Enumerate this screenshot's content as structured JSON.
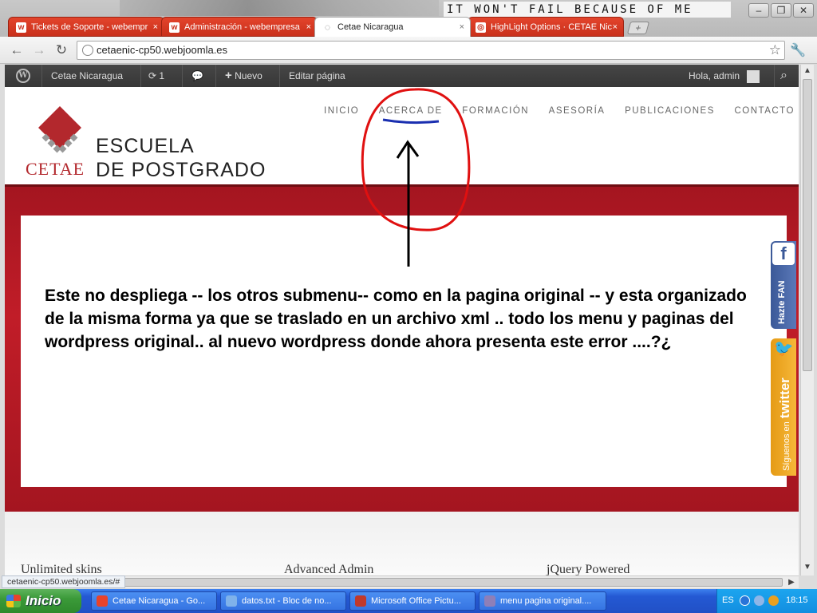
{
  "window": {
    "handwriting": "IT WON'T FAIL BECAUSE OF ME",
    "controls": {
      "minimize": "–",
      "restore": "❐",
      "close": "✕"
    }
  },
  "tabs": [
    {
      "label": "Tickets de Soporte - webempr",
      "favicon": "w",
      "close": "×"
    },
    {
      "label": "Administración - webempresa",
      "favicon": "w",
      "close": "×"
    },
    {
      "label": "Cetae Nicaragua",
      "favicon": "◌",
      "close": "×"
    },
    {
      "label": "HighLight Options · CETAE Nic",
      "favicon": "◎",
      "close": "×"
    }
  ],
  "toolbar": {
    "back": "←",
    "forward": "→",
    "reload": "↻",
    "url": "cetaenic-cp50.webjoomla.es",
    "star": "☆",
    "wrench": "🔧"
  },
  "adminbar": {
    "site_name": "Cetae Nicaragua",
    "updates_icon": "⟳",
    "updates_count": "1",
    "comments_icon": "💬",
    "new_icon": "+",
    "new_label": "Nuevo",
    "edit_label": "Editar página",
    "greeting": "Hola, admin",
    "search_icon": "⌕"
  },
  "logo": {
    "cetae": "CETAE",
    "line1": "ESCUELA",
    "line2": "DE POSTGRADO"
  },
  "nav": [
    "INICIO",
    "ACERCA DE",
    "FORMACIÓN",
    "ASESORÍA",
    "PUBLICACIONES",
    "CONTACTO"
  ],
  "message": "Este no despliega -- los otros submenu-- como en la pagina original -- y esta organizado de la misma forma ya que se traslado en un archivo xml .. todo los menu y paginas del wordpress original.. al nuevo wordpress donde ahora presenta este error ....?¿",
  "features": [
    "Unlimited skins",
    "Advanced Admin",
    "jQuery Powered"
  ],
  "social": {
    "facebook_label": "Hazte FAN",
    "facebook_icon": "f",
    "twitter_prefix": "Síguenos en",
    "twitter_brand": "twitter",
    "twitter_icon": "🐦"
  },
  "status_url": "cetaenic-cp50.webjoomla.es/#",
  "taskbar": {
    "start": "Inicio",
    "tasks": [
      {
        "label": "Cetae Nicaragua - Go...",
        "color": "#e8432b"
      },
      {
        "label": "datos.txt - Bloc de no...",
        "color": "#7fb2ea"
      },
      {
        "label": "Microsoft Office Pictu...",
        "color": "#c0392b"
      },
      {
        "label": "menu pagina original....",
        "color": "#8e7fb8"
      }
    ],
    "lang": "ES",
    "clock": "18:15"
  },
  "colors": {
    "brand_red": "#b3282d",
    "admin_bar": "#464646",
    "annotation_red": "#e01010",
    "annotation_blue": "#1a2fb0"
  }
}
